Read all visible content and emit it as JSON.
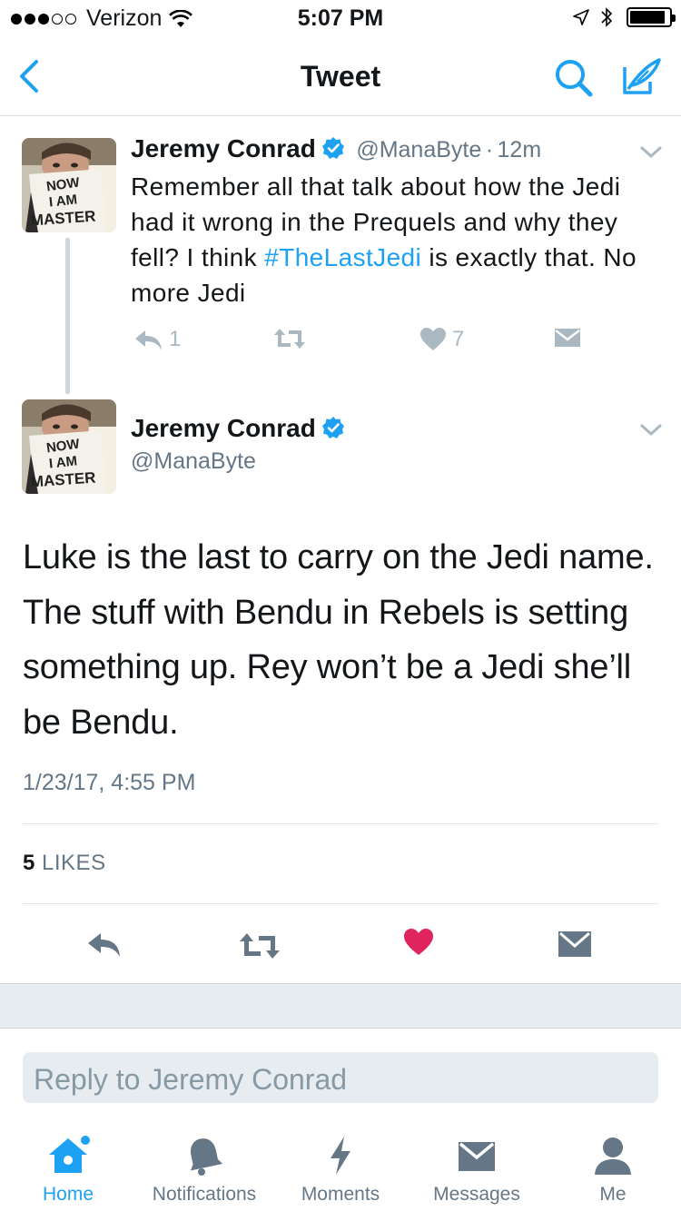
{
  "status_bar": {
    "carrier": "Verizon",
    "time": "5:07 PM",
    "signal_bars": 3,
    "signal_total": 5,
    "battery_level": 0.9
  },
  "nav": {
    "title": "Tweet"
  },
  "parent_tweet": {
    "author_name": "Jeremy Conrad",
    "handle": "@ManaByte",
    "separator": "·",
    "age": "12m",
    "text_before": "Remember all that talk about how the Jedi had it wrong in the Prequels and why they fell? I think ",
    "hashtag": "#TheLastJedi",
    "text_after": " is exactly that. No more Jedi",
    "reply_count": "1",
    "like_count": "7"
  },
  "main_tweet": {
    "author_name": "Jeremy Conrad",
    "handle": "@ManaByte",
    "text": "Luke is the last to carry on the Jedi name. The stuff with Bendu in Rebels is setting something up. Rey won’t be a Jedi she’ll be Bendu.",
    "timestamp": "1/23/17, 4:55 PM",
    "likes_count": "5",
    "likes_label": "LIKES"
  },
  "reply": {
    "placeholder": "Reply to Jeremy Conrad"
  },
  "tabs": [
    {
      "label": "Home",
      "icon": "home-icon"
    },
    {
      "label": "Notifications",
      "icon": "bell-icon"
    },
    {
      "label": "Moments",
      "icon": "lightning-icon"
    },
    {
      "label": "Messages",
      "icon": "envelope-icon"
    },
    {
      "label": "Me",
      "icon": "person-icon"
    }
  ],
  "colors": {
    "accent": "#1da1f2",
    "like": "#e0245e",
    "muted": "#657786",
    "icon_gray": "#aab8c2"
  }
}
